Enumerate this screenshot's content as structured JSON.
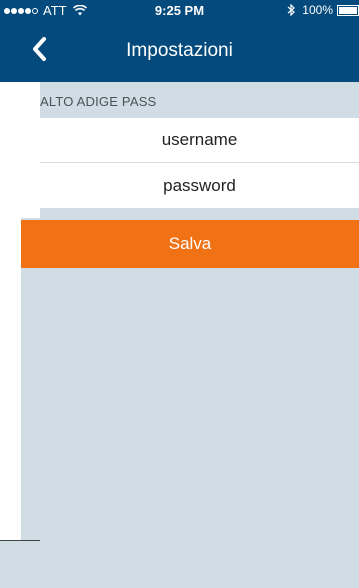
{
  "status_bar": {
    "carrier": "ATT",
    "time": "9:25 PM",
    "battery_percent": "100%"
  },
  "navbar": {
    "title": "Impostazioni",
    "back_icon": "chevron-left-icon"
  },
  "section": {
    "header": "ALTO ADIGE PASS"
  },
  "form": {
    "username_placeholder": "username",
    "password_placeholder": "password"
  },
  "actions": {
    "save_label": "Salva"
  },
  "colors": {
    "navbar_bg": "#054a7c",
    "page_bg": "#d0dde5",
    "save_button": "#f07215"
  }
}
